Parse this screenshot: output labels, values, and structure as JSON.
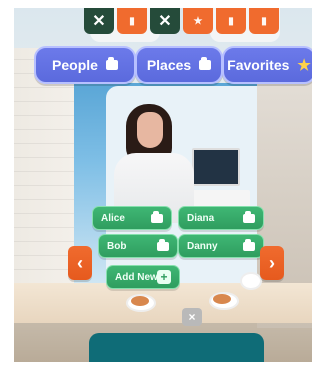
{
  "top_tabs": [
    {
      "icon": "close-icon",
      "style": "dark"
    },
    {
      "icon": "tab-icon",
      "style": "orange"
    },
    {
      "icon": "close-icon",
      "style": "dark"
    },
    {
      "icon": "star-icon",
      "style": "orange"
    },
    {
      "icon": "tab-icon",
      "style": "orange"
    },
    {
      "icon": "tab-icon",
      "style": "orange"
    }
  ],
  "categories": [
    {
      "label": "People",
      "icon": "folder-icon"
    },
    {
      "label": "Places",
      "icon": "folder-icon"
    },
    {
      "label": "Favorites",
      "icon": "star-icon"
    }
  ],
  "contacts": [
    {
      "label": "Alice",
      "icon": "folder-icon"
    },
    {
      "label": "Diana",
      "icon": "folder-icon"
    },
    {
      "label": "Bob",
      "icon": "folder-icon"
    },
    {
      "label": "Danny",
      "icon": "folder-icon"
    },
    {
      "label": "Add New",
      "icon": "plus-icon"
    }
  ],
  "navigation": {
    "prev": "‹",
    "next": "›"
  },
  "close": {
    "label": "×"
  },
  "colors": {
    "category_pill": "#5b6add",
    "contact_button": "#2f9d5f",
    "arrow": "#f06b2e",
    "top_tab_dark": "#254b3a"
  }
}
